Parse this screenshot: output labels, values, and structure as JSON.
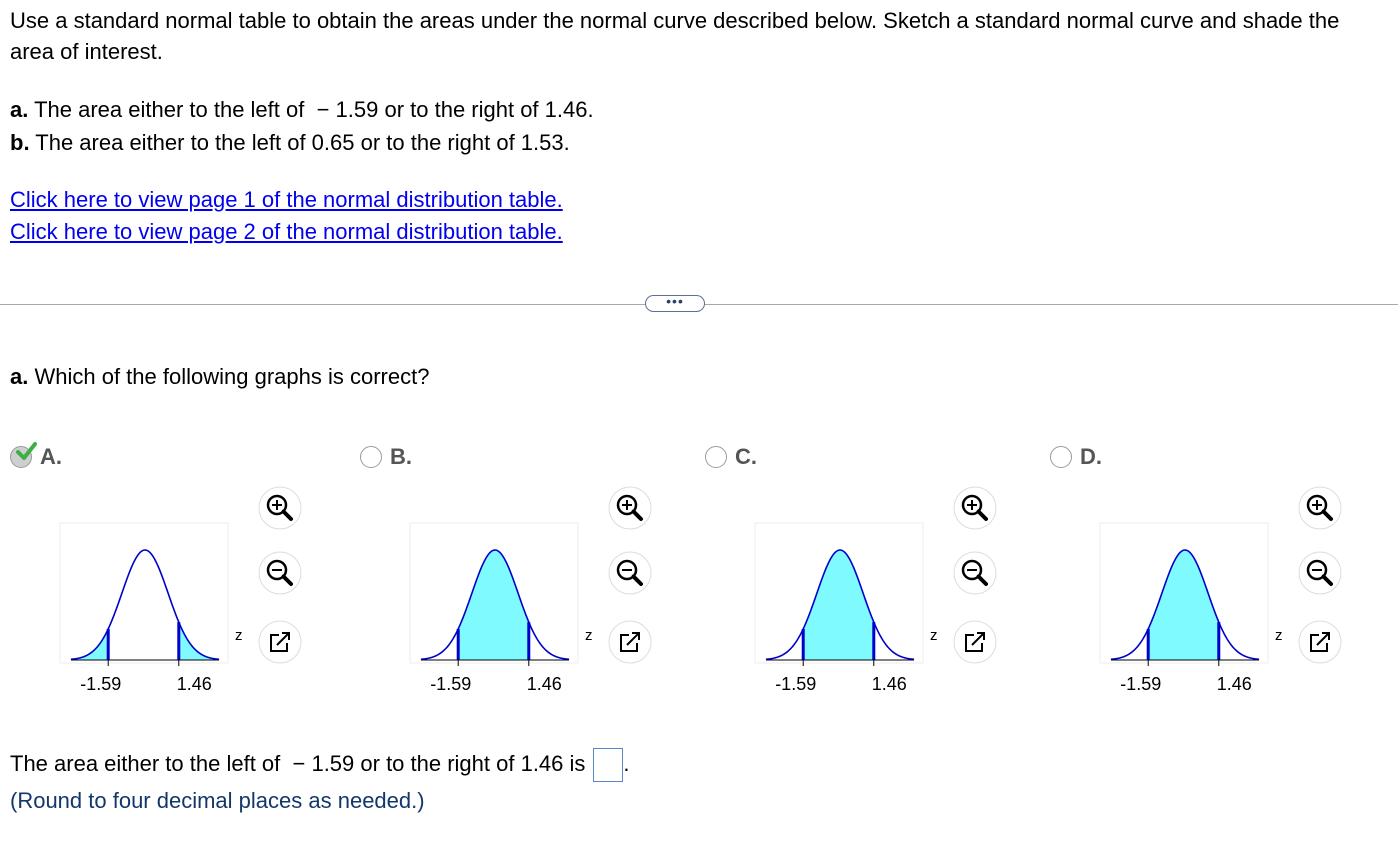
{
  "intro": "Use a standard normal table to obtain the areas under the normal curve described below. Sketch a standard normal curve and shade the area of interest.",
  "parts": [
    {
      "label": "a.",
      "text": " The area either to the left of  − 1.59 or to the right of 1.46."
    },
    {
      "label": "b.",
      "text": " The area either to the left of 0.65 or to the right of 1.53."
    }
  ],
  "links": [
    "Click here to view page 1 of the normal distribution table.",
    "Click here to view page 2 of the normal distribution table."
  ],
  "expand_label": "•••",
  "question": {
    "label": "a.",
    "text": " Which of the following graphs is correct?"
  },
  "options": [
    {
      "letter": "A.",
      "selected": true,
      "shading": "tails",
      "left_tick": "-1.59",
      "right_tick": "1.46",
      "axis_label": "z"
    },
    {
      "letter": "B.",
      "selected": false,
      "shading": "middle",
      "left_tick": "-1.59",
      "right_tick": "1.46",
      "axis_label": "z"
    },
    {
      "letter": "C.",
      "selected": false,
      "shading": "middle",
      "left_tick": "-1.59",
      "right_tick": "1.46",
      "axis_label": "z"
    },
    {
      "letter": "D.",
      "selected": false,
      "shading": "middle",
      "left_tick": "-1.59",
      "right_tick": "1.46",
      "axis_label": "z"
    }
  ],
  "answer": {
    "prefix": "The area either to the left of  − 1.59 or to the right of 1.46 is",
    "suffix": ".",
    "value": ""
  },
  "note": "(Round to four decimal places as needed.)",
  "colors": {
    "curve": "#0000cc",
    "shade": "#7ffaff",
    "link": "#0000ee",
    "check": "#3cb043"
  },
  "icons": [
    "zoom-in-icon",
    "zoom-out-icon",
    "open-new-window-icon",
    "checkmark-icon"
  ]
}
